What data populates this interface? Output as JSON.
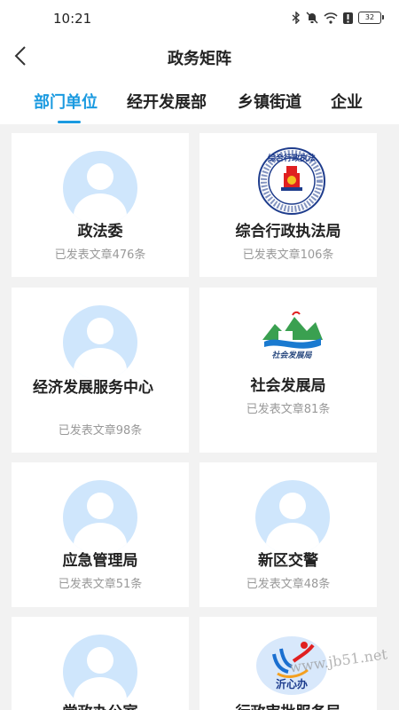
{
  "status": {
    "time": "10:21",
    "battery": "32"
  },
  "nav": {
    "title": "政务矩阵"
  },
  "tabs": [
    "部门单位",
    "经开发展部",
    "乡镇街道",
    "企业"
  ],
  "cards": [
    {
      "name": "政法委",
      "count": "已发表文章476条"
    },
    {
      "name": "综合行政执法局",
      "count": "已发表文章106条"
    },
    {
      "name": "经济发展服务中心",
      "count": "已发表文章98条"
    },
    {
      "name": "社会发展局",
      "count": "已发表文章81条"
    },
    {
      "name": "应急管理局",
      "count": "已发表文章51条"
    },
    {
      "name": "新区交警",
      "count": "已发表文章48条"
    },
    {
      "name": "党政办公室",
      "count": ""
    },
    {
      "name": "行政审批服务局",
      "count": ""
    }
  ],
  "logos": {
    "enforcement_text": "综合行政执法",
    "social_text": "社会发展局",
    "yixinban_text": "沂心办"
  },
  "watermark": "www.jb51.net"
}
